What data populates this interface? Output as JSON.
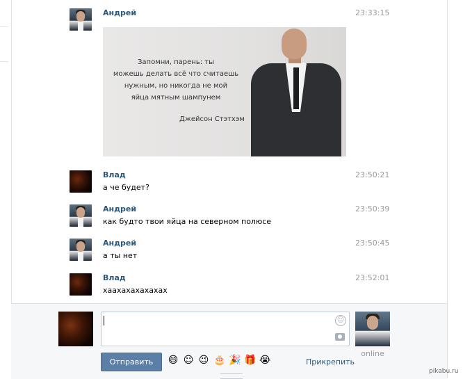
{
  "messages": [
    {
      "author": "Андрей",
      "time": "23:33:15",
      "avatar": "andrey",
      "text": "",
      "attachment": {
        "quote_lines": [
          "Запомни, парень: ты",
          "можешь делать всё что считаешь",
          "нужным, но никогда не мой",
          "яйца мятным шампунем"
        ],
        "author": "Джейсон Стэтхэм"
      }
    },
    {
      "author": "Влад",
      "time": "23:50:21",
      "avatar": "vlad",
      "text": "а че будет?"
    },
    {
      "author": "Андрей",
      "time": "23:50:39",
      "avatar": "andrey",
      "text": "как будто твои яйца на северном полюсе"
    },
    {
      "author": "Андрей",
      "time": "23:50:45",
      "avatar": "andrey",
      "text": "а ты нет"
    },
    {
      "author": "Влад",
      "time": "23:52:01",
      "avatar": "vlad",
      "text": "хаахахахахахах"
    }
  ],
  "composer": {
    "input_value": "",
    "send_label": "Отправить",
    "attach_label": "Прикрепить",
    "emojis": [
      "😄",
      "☺",
      "😉",
      "🎂",
      "🎉",
      "🎁",
      "😭"
    ],
    "smile_icon": "smile-icon",
    "camera_icon": "camera-icon"
  },
  "peer": {
    "status": "online"
  },
  "watermark": "pikabu.ru",
  "colors": {
    "name_link": "#2b587a",
    "send_button": "#5b7fa6",
    "timestamp": "#999999"
  }
}
